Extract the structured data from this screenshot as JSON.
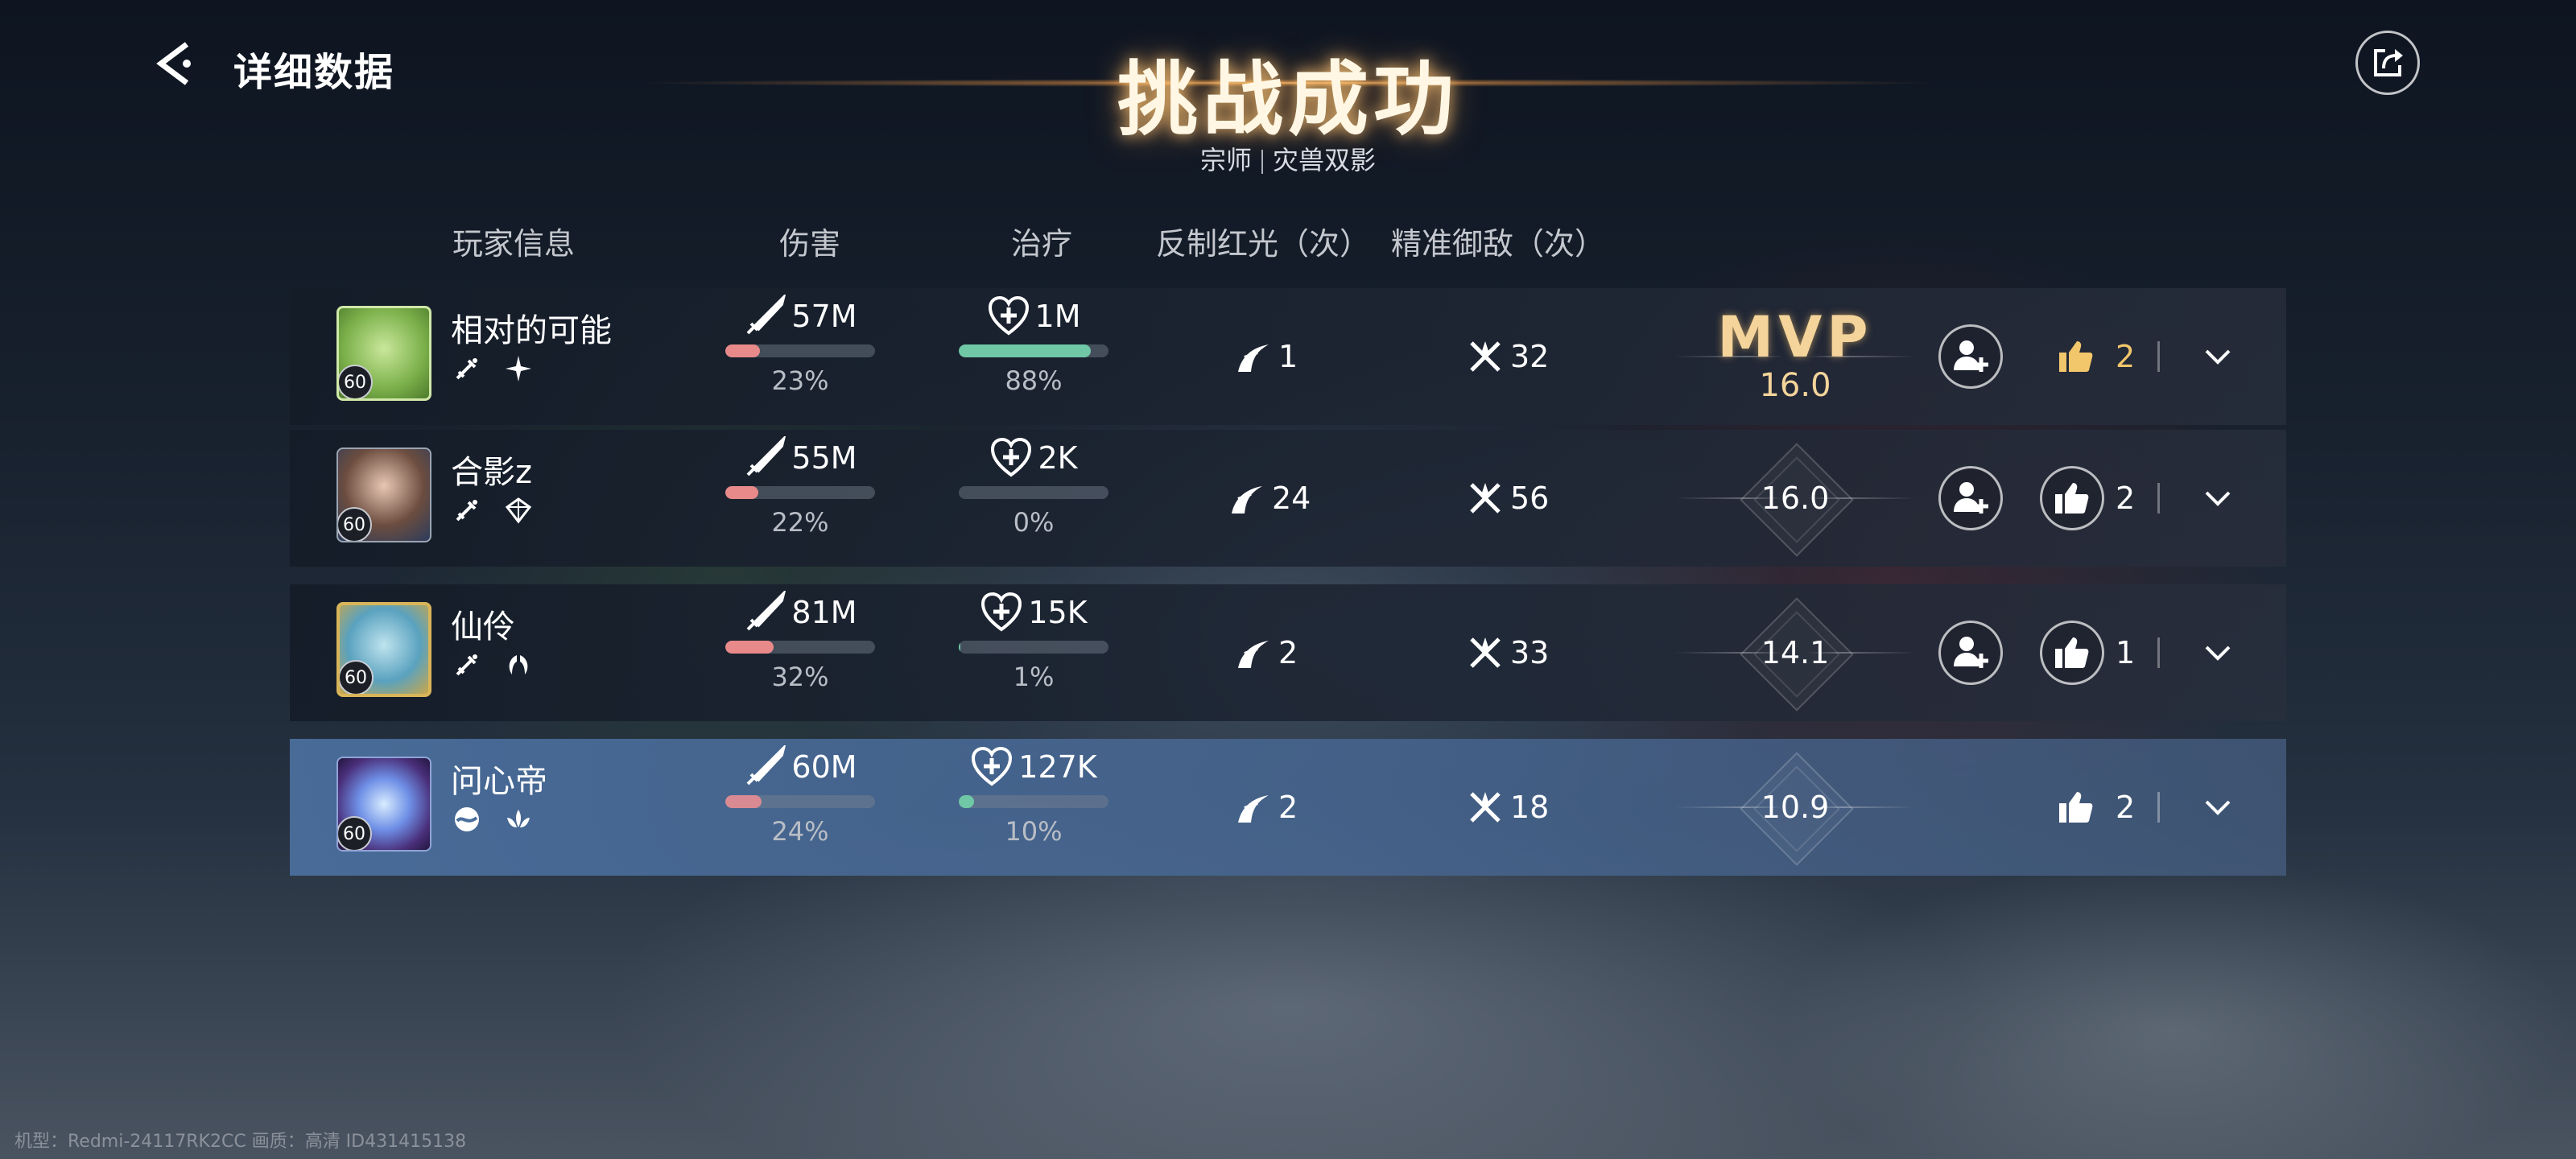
{
  "header": {
    "back_icon": "back-arrow-icon",
    "title": "详细数据",
    "main_title": "挑战成功",
    "difficulty": "宗师",
    "stage": "灾兽双影",
    "share_icon": "share-icon"
  },
  "columns": {
    "player": "玩家信息",
    "damage": "伤害",
    "heal": "治疗",
    "counter": "反制红光（次）",
    "guard": "精准御敌（次）"
  },
  "players": [
    {
      "name": "相对的可能",
      "level": "60",
      "damage": "57M",
      "damage_pct": "23%",
      "damage_ratio": 0.23,
      "heal": "1M",
      "heal_pct": "88%",
      "heal_ratio": 0.88,
      "counter": "1",
      "guard": "32",
      "score": "16.0",
      "mvp_label": "MVP",
      "is_mvp": true,
      "likes": "2",
      "liked": true,
      "can_add_friend": true,
      "selected": false
    },
    {
      "name": "合影z",
      "level": "60",
      "damage": "55M",
      "damage_pct": "22%",
      "damage_ratio": 0.22,
      "heal": "2K",
      "heal_pct": "0%",
      "heal_ratio": 0.0,
      "counter": "24",
      "guard": "56",
      "score": "16.0",
      "is_mvp": false,
      "likes": "2",
      "liked": false,
      "can_add_friend": true,
      "selected": false
    },
    {
      "name": "仙伶",
      "level": "60",
      "damage": "81M",
      "damage_pct": "32%",
      "damage_ratio": 0.32,
      "heal": "15K",
      "heal_pct": "1%",
      "heal_ratio": 0.01,
      "counter": "2",
      "guard": "33",
      "score": "14.1",
      "is_mvp": false,
      "likes": "1",
      "liked": false,
      "can_add_friend": true,
      "selected": false
    },
    {
      "name": "问心帝",
      "level": "60",
      "damage": "60M",
      "damage_pct": "24%",
      "damage_ratio": 0.24,
      "heal": "127K",
      "heal_pct": "10%",
      "heal_ratio": 0.1,
      "counter": "2",
      "guard": "18",
      "score": "10.9",
      "is_mvp": false,
      "likes": "2",
      "liked": false,
      "can_add_friend": false,
      "selected": true
    }
  ],
  "colors": {
    "damage_bar": "#e88a8a",
    "damage_bar_self": "#d98a92",
    "heal_bar": "#6fc7a6",
    "mvp_gold": "#f4d49a",
    "selected_row": "#4a6e9c"
  },
  "footer": {
    "device_info": "机型：Redmi-24117RK2CC 画质：高清 ID431415138"
  }
}
